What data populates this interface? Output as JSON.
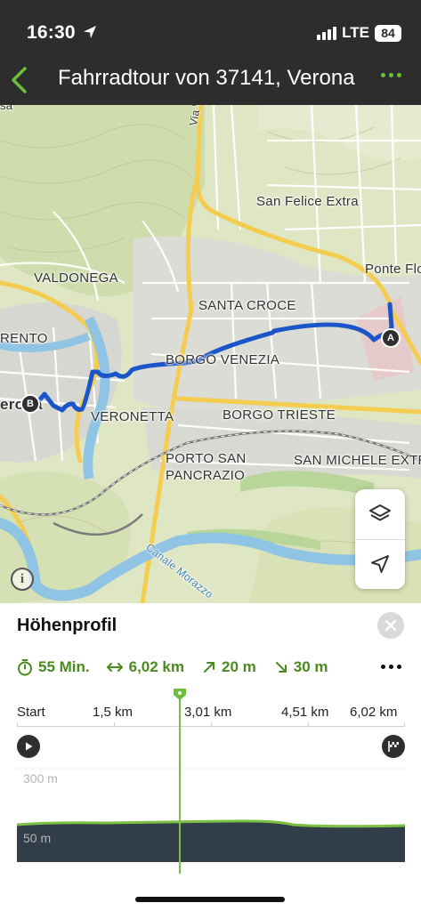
{
  "status_bar": {
    "time": "16:30",
    "network": "LTE",
    "battery": "84"
  },
  "header": {
    "title": "Fahrradtour von 37141, Verona"
  },
  "map": {
    "labels": {
      "via": "Via Va",
      "san_felice": "San Felice Extra",
      "ponte": "Ponte Flo",
      "valdonega": "VALDONEGA",
      "santa_croce": "SANTA CROCE",
      "rento": "RENTO",
      "borgo_venezia": "BORGO VENEZIA",
      "veronetta": "VERONETTA",
      "borgo_trieste": "BORGO TRIESTE",
      "porto_san": "PORTO SAN",
      "pancrazio": "PANCRAZIO",
      "san_michele": "SAN MICHELE EXTR",
      "canale": "Canale Morazzo",
      "verona_partial": "erona",
      "sa_partial": "sa"
    },
    "markers": {
      "start": "A",
      "end": "B"
    },
    "info_label": "i"
  },
  "profile": {
    "title": "Höhenprofil",
    "duration": "55 Min.",
    "distance": "6,02 km",
    "ascent": "20 m",
    "descent": "30 m",
    "axis_labels": [
      "Start",
      "1,5 km",
      "3,01 km",
      "4,51 km",
      "6,02 km"
    ],
    "elevation_top": "300 m",
    "elevation_bottom": "50 m",
    "colors": {
      "accent": "#6bbf3a",
      "route": "#1a56c9",
      "profile_fill": "#313d48"
    }
  }
}
